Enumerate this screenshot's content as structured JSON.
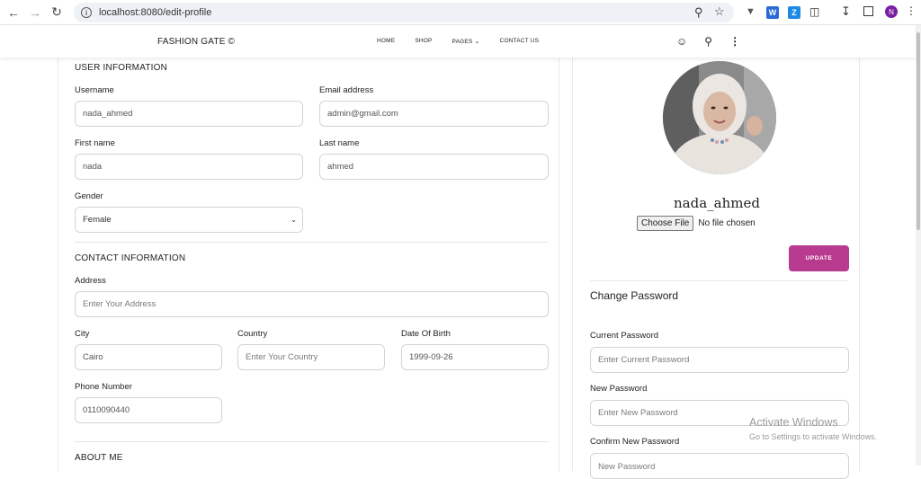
{
  "browser": {
    "url": "localhost:8080/edit-profile",
    "profile_initial": "N"
  },
  "header": {
    "brand": "FASHION GATE ©",
    "menu": [
      "HOME",
      "SHOP",
      "PAGES",
      "CONTACT US"
    ]
  },
  "user_info": {
    "title": "USER INFORMATION",
    "username_label": "Username",
    "username_value": "nada_ahmed",
    "email_label": "Email address",
    "email_value": "admin@gmail.com",
    "firstname_label": "First name",
    "firstname_value": "nada",
    "lastname_label": "Last name",
    "lastname_value": "ahmed",
    "gender_label": "Gender",
    "gender_value": "Female"
  },
  "contact_info": {
    "title": "CONTACT INFORMATION",
    "address_label": "Address",
    "address_placeholder": "Enter Your Address",
    "city_label": "City",
    "city_value": "Cairo",
    "country_label": "Country",
    "country_placeholder": "Enter Your Country",
    "dob_label": "Date Of Birth",
    "dob_value": "1999-09-26",
    "phone_label": "Phone Number",
    "phone_value": "0110090440"
  },
  "about": {
    "title": "ABOUT ME"
  },
  "profile": {
    "name": "nada_ahmed",
    "choose_file": "Choose File",
    "no_file": "No file chosen",
    "update_label": "UPDATE"
  },
  "password": {
    "title": "Change Password",
    "current_label": "Current Password",
    "current_placeholder": "Enter Current Password",
    "new_label": "New Password",
    "new_placeholder": "Enter New Password",
    "confirm_label": "Confirm New Password",
    "confirm_placeholder": "New Password"
  },
  "watermark": {
    "line1": "Activate Windows",
    "line2": "Go to Settings to activate Windows."
  }
}
